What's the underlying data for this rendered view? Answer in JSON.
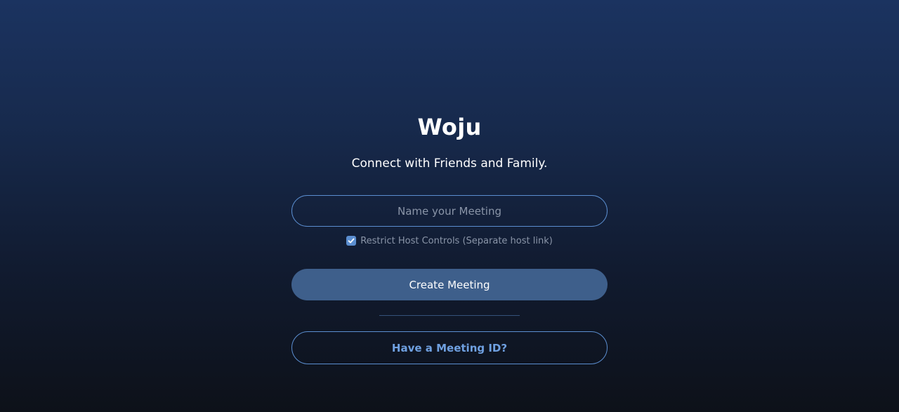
{
  "app": {
    "title": "Woju",
    "tagline": "Connect with Friends and Family."
  },
  "form": {
    "meeting_name_placeholder": "Name your Meeting",
    "meeting_name_value": "",
    "restrict_host": {
      "label": "Restrict Host Controls (Separate host link)",
      "checked": true
    },
    "create_button_label": "Create Meeting",
    "join_button_label": "Have a Meeting ID?"
  },
  "icons": {
    "checkbox_checkmark": "check-icon"
  },
  "colors": {
    "accent": "#5b8ed0",
    "create_button_bg": "#3e5f8b",
    "join_text": "#6fa0e0",
    "muted_text": "#8a95a8"
  }
}
